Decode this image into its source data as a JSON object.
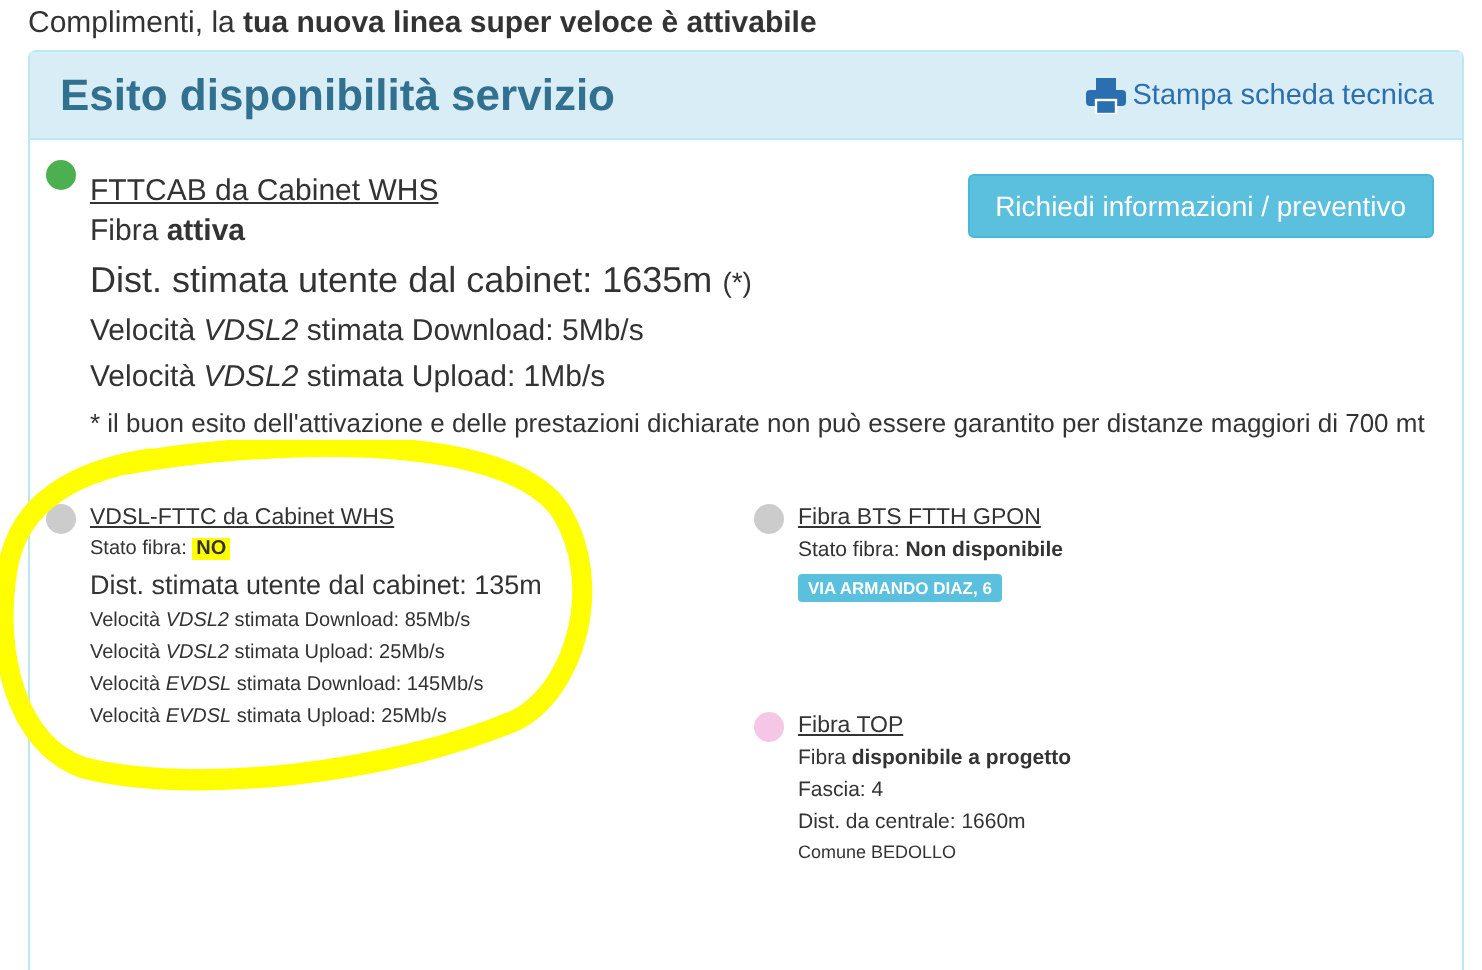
{
  "intro": "Complimenti, la **tua nuova linea super veloce è attivabile**",
  "panel": {
    "title": "Esito disponibilità servizio",
    "print_link": "Stampa scheda tecnica"
  },
  "main_service": {
    "color": "#4caf50",
    "name": "FTTCAB da Cabinet WHS",
    "status_label": "Fibra",
    "status_value": "attiva",
    "distance": "Dist. stimata utente dal cabinet: 1635m",
    "distance_note": "(*)",
    "speeds": [
      "Velocità *VDSL2* stimata Download: 5Mb/s",
      "Velocità *VDSL2* stimata Upload: 1Mb/s"
    ],
    "note": "* il buon esito dell'attivazione e delle prestazioni dichiarate non può essere garantito per distanze maggiori di 700 mt",
    "button": "Richiedi informazioni / preventivo"
  },
  "left_services": [
    {
      "color": "#cccccc",
      "name": "VDSL-FTTC da Cabinet WHS",
      "circled": true,
      "lines": [
        {
          "kind": "status",
          "label": "Stato fibra:",
          "value": "NO",
          "highlighted": true
        },
        {
          "kind": "distance",
          "text": "Dist. stimata utente dal cabinet: 135m"
        },
        {
          "kind": "speed",
          "text": "Velocità *VDSL2* stimata Download: 85Mb/s"
        },
        {
          "kind": "speed",
          "text": "Velocità *VDSL2* stimata Upload: 25Mb/s"
        },
        {
          "kind": "speed",
          "text": "Velocità *EVDSL* stimata Download: 145Mb/s"
        },
        {
          "kind": "speed",
          "text": "Velocità *EVDSL* stimata Upload: 25Mb/s"
        }
      ]
    }
  ],
  "right_services": [
    {
      "color": "#cccccc",
      "name": "Fibra BTS FTTH GPON",
      "circled": false,
      "lines": [
        {
          "kind": "status",
          "label": "Stato fibra:",
          "value": "Non disponibile",
          "highlighted": false
        },
        {
          "kind": "tag",
          "text": "VIA ARMANDO DIAZ, 6"
        }
      ]
    },
    {
      "color": "#f5c6e6",
      "name": "Fibra TOP",
      "circled": false,
      "lines": [
        {
          "kind": "status",
          "label": "Fibra",
          "value": "disponibile a progetto",
          "highlighted": false
        },
        {
          "kind": "plain",
          "text": "Fascia: 4"
        },
        {
          "kind": "plain",
          "text": "Dist. da centrale: 1660m"
        },
        {
          "kind": "small",
          "text": "Comune BEDOLLO"
        }
      ]
    }
  ]
}
